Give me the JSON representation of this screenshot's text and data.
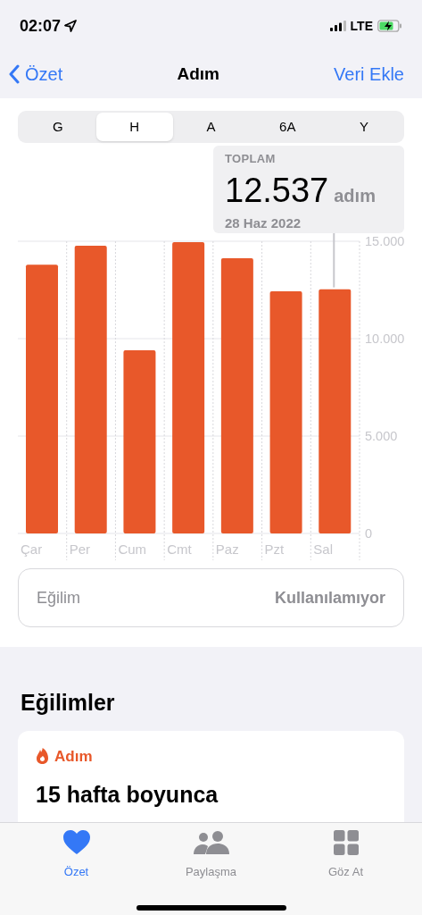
{
  "status_bar": {
    "time": "02:07",
    "network": "LTE"
  },
  "nav": {
    "back": "Özet",
    "title": "Adım",
    "action": "Veri Ekle"
  },
  "segments": [
    {
      "label": "G",
      "selected": false
    },
    {
      "label": "H",
      "selected": true
    },
    {
      "label": "A",
      "selected": false
    },
    {
      "label": "6A",
      "selected": false
    },
    {
      "label": "Y",
      "selected": false
    }
  ],
  "tooltip": {
    "label": "TOPLAM",
    "value": "12.537",
    "unit": "adım",
    "date": "28 Haz 2022"
  },
  "chart_data": {
    "type": "bar",
    "categories": [
      "Çar",
      "Per",
      "Cum",
      "Cmt",
      "Paz",
      "Pzt",
      "Sal"
    ],
    "ylim": [
      0,
      15000
    ],
    "yticks": [
      {
        "value": 0,
        "label": "0"
      },
      {
        "value": 5000,
        "label": "5.000"
      },
      {
        "value": 10000,
        "label": "10.000"
      },
      {
        "value": 15000,
        "label": "15.000"
      }
    ],
    "series": [
      {
        "color": "#e8582a",
        "values": [
          13800,
          14770,
          9400,
          14950,
          14130,
          12430,
          12540
        ]
      }
    ]
  },
  "trend_row": {
    "label": "Eğilim",
    "value": "Kullanılamıyor"
  },
  "trends": {
    "heading": "Eğilimler",
    "card": {
      "category": "Adım",
      "title": "15 hafta boyunca"
    }
  },
  "tab_bar": [
    {
      "label": "Özet",
      "kind": "heart",
      "selected": true
    },
    {
      "label": "Paylaşma",
      "kind": "people",
      "selected": false
    },
    {
      "label": "Göz At",
      "kind": "grid",
      "selected": false
    }
  ]
}
